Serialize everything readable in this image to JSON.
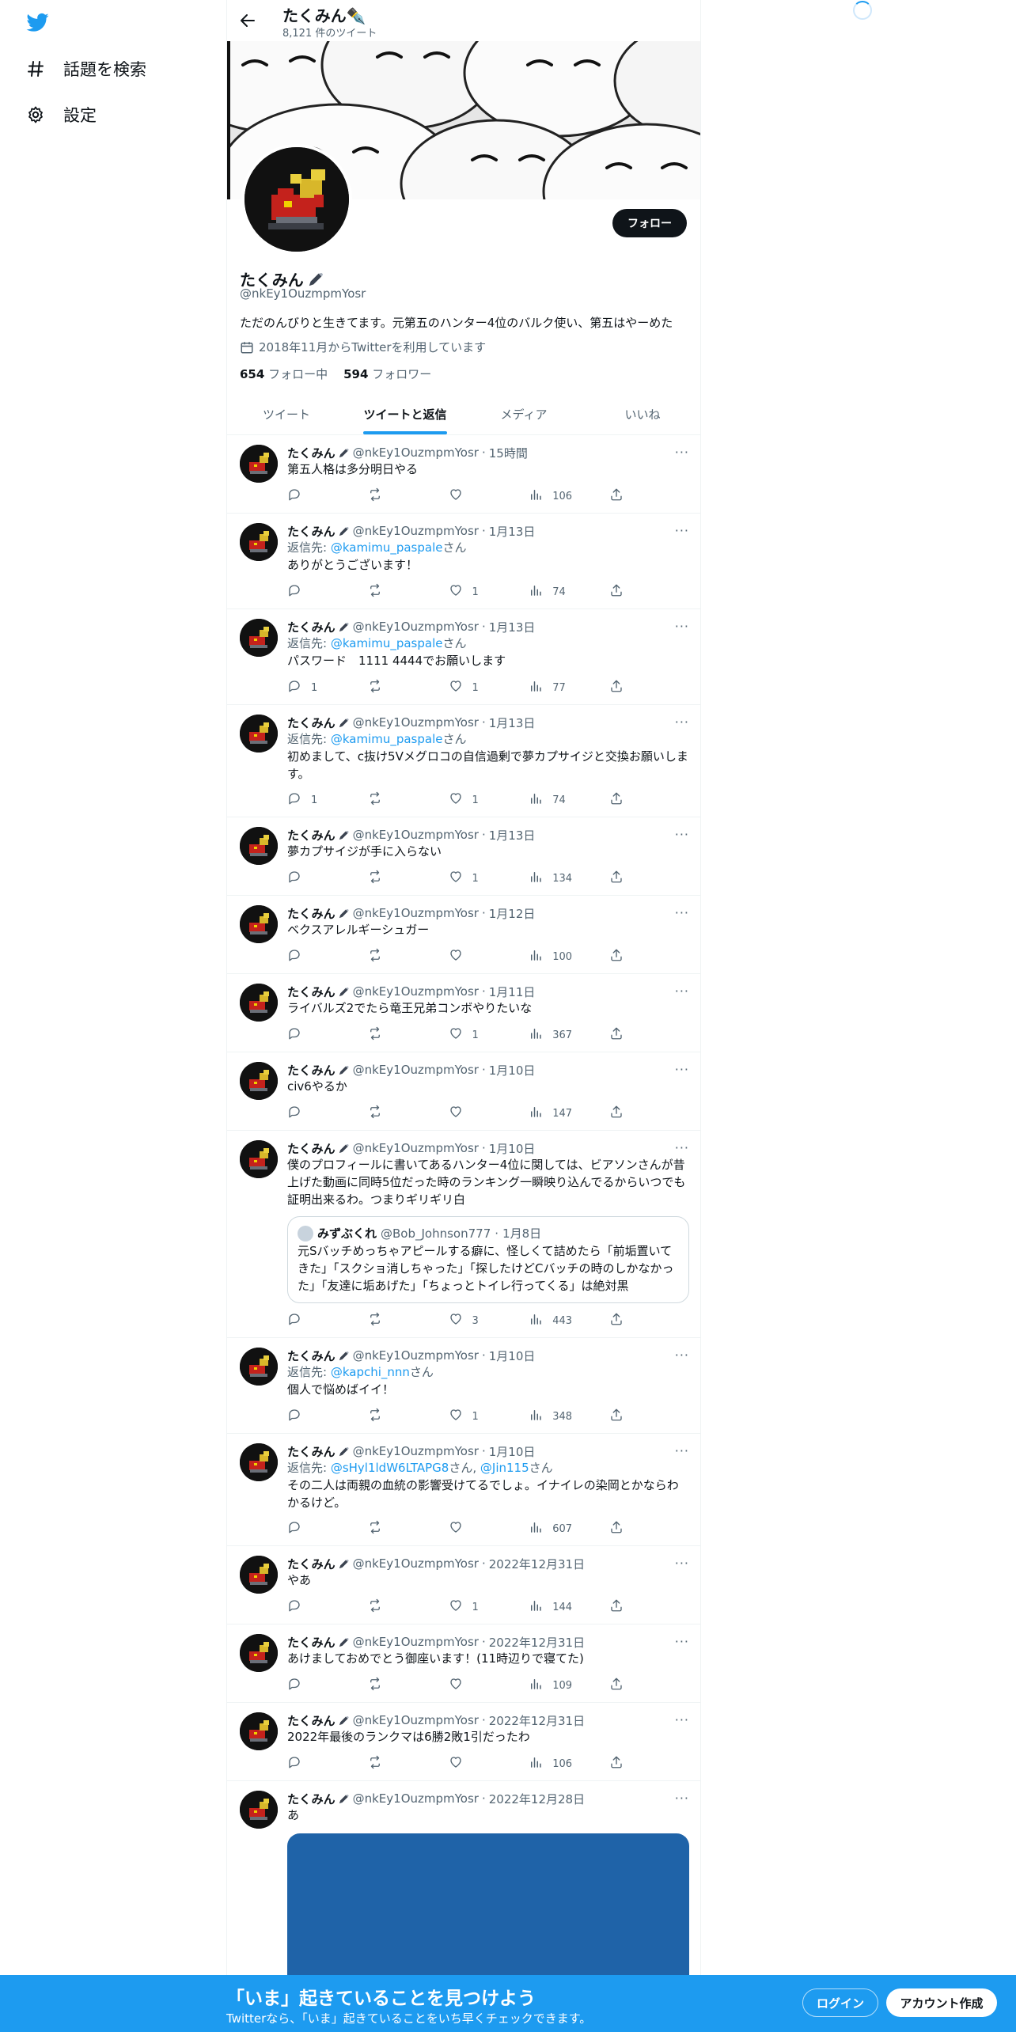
{
  "nav": {
    "explore_label": "話題を検索",
    "settings_label": "設定"
  },
  "topbar": {
    "title": "たくみん✒️",
    "tweet_count": "8,121 件のツイート"
  },
  "profile": {
    "name": "たくみん",
    "handle": "@nkEy1OuzmpmYosr",
    "bio": "ただのんびりと生きてます。元第五のハンター4位のバルク使い、第五はやーめた",
    "joined": "2018年11月からTwitterを利用しています",
    "following_count": "654",
    "following_label": "フォロー中",
    "followers_count": "594",
    "followers_label": "フォロワー",
    "follow_button": "フォロー"
  },
  "tabs": [
    {
      "label": "ツイート"
    },
    {
      "label": "ツイートと返信"
    },
    {
      "label": "メディア"
    },
    {
      "label": "いいね"
    }
  ],
  "tweet_author": {
    "name": "たくみん",
    "handle": "@nkEy1OuzmpmYosr",
    "more": "···"
  },
  "reply_prefix": "返信先: ",
  "reply_suffix": "さん",
  "tweets": [
    {
      "time": "15時間",
      "text": "第五人格は多分明日やる",
      "replies": "",
      "likes": "",
      "views": "106"
    },
    {
      "time": "1月13日",
      "reply_to": "@kamimu_paspale",
      "text": "ありがとうございます！",
      "replies": "",
      "likes": "1",
      "views": "74"
    },
    {
      "time": "1月13日",
      "reply_to": "@kamimu_paspale",
      "text": "パスワード　1111 4444でお願いします",
      "replies": "1",
      "likes": "1",
      "views": "77"
    },
    {
      "time": "1月13日",
      "reply_to": "@kamimu_paspale",
      "text": "初めまして、c抜け5Vメグロコの自信過剰で夢カプサイジと交換お願いします。",
      "replies": "1",
      "likes": "1",
      "views": "74"
    },
    {
      "time": "1月13日",
      "text": "夢カプサイジが手に入らない",
      "replies": "",
      "likes": "1",
      "views": "134"
    },
    {
      "time": "1月12日",
      "text": "ベクスアレルギーシュガー",
      "replies": "",
      "likes": "",
      "views": "100"
    },
    {
      "time": "1月11日",
      "text": "ライバルズ2でたら竜王兄弟コンボやりたいな",
      "replies": "",
      "likes": "1",
      "views": "367"
    },
    {
      "time": "1月10日",
      "text": "civ6やるか",
      "replies": "",
      "likes": "",
      "views": "147"
    },
    {
      "time": "1月10日",
      "text": "僕のプロフィールに書いてあるハンター4位に関しては、ビアソンさんが昔上げた動画に同時5位だった時のランキング一瞬映り込んでるからいつでも証明出来るわ。つまりギリギリ白",
      "quote": {
        "name": "みずぶくれ",
        "handle": "@Bob_Johnson777",
        "time": "1月8日",
        "text": "元Sバッチめっちゃアピールする癖に、怪しくて詰めたら「前垢置いてきた」「スクショ消しちゃった」「探したけどCバッチの時のしかなかった」「友達に垢あげた」「ちょっとトイレ行ってくる」は絶対黒"
      },
      "replies": "",
      "likes": "3",
      "views": "443"
    },
    {
      "time": "1月10日",
      "reply_to": "@kapchi_nnn",
      "text": "個人で悩めばイイ！",
      "replies": "",
      "likes": "1",
      "views": "348"
    },
    {
      "time": "1月10日",
      "reply_to": "@sHyl1ldW6LTAPG8",
      "reply_to2": "@Jin115",
      "text": "その二人は両親の血統の影響受けてるでしょ。イナイレの染岡とかならわかるけど。",
      "replies": "",
      "likes": "",
      "views": "607"
    },
    {
      "time": "2022年12月31日",
      "text": "やあ",
      "replies": "",
      "likes": "1",
      "views": "144"
    },
    {
      "time": "2022年12月31日",
      "text": "あけましておめでとう御座います！(11時辺りで寝てた)",
      "replies": "",
      "likes": "",
      "views": "109"
    },
    {
      "time": "2022年12月31日",
      "text": "2022年最後のランクマは6勝2敗1引だったわ",
      "replies": "",
      "likes": "",
      "views": "106"
    },
    {
      "time": "2022年12月28日",
      "text": "あ",
      "media": true
    }
  ],
  "bottom_bar": {
    "title": "「いま」起きていることを見つけよう",
    "subtitle": "Twitterなら、「いま」起きていることをいち早くチェックできます。",
    "login": "ログイン",
    "signup": "アカウント作成"
  },
  "colors": {
    "accent": "#1d9bf0",
    "text": "#0f1419",
    "secondary": "#536471"
  }
}
